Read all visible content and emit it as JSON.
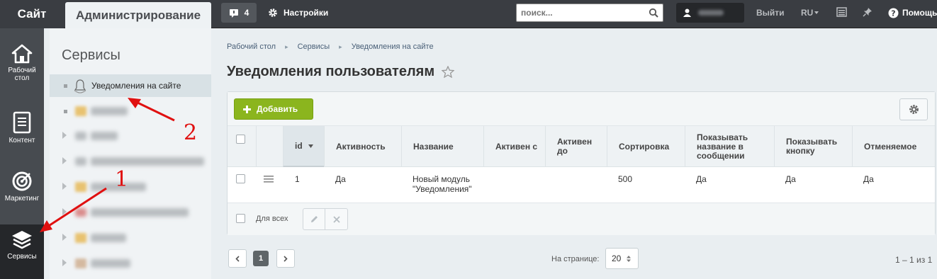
{
  "topbar": {
    "site_tab": "Сайт",
    "admin_tab": "Администрирование",
    "notifications_count": "4",
    "settings_label": "Настройки",
    "search_placeholder": "поиск...",
    "logout_label": "Выйти",
    "lang_label": "RU",
    "help_label": "Помощь"
  },
  "left_nav": {
    "items": [
      {
        "label": "Рабочий стол",
        "icon": "home-icon"
      },
      {
        "label": "Контент",
        "icon": "document-icon"
      },
      {
        "label": "Маркетинг",
        "icon": "target-icon"
      },
      {
        "label": "Сервисы",
        "icon": "layers-icon",
        "active": true
      }
    ]
  },
  "sidebar": {
    "title": "Сервисы",
    "active_item": "Уведомления на сайте"
  },
  "breadcrumbs": [
    "Рабочий стол",
    "Сервисы",
    "Уведомления на сайте"
  ],
  "page_title": "Уведомления пользователям",
  "toolbar": {
    "add_label": "Добавить"
  },
  "table": {
    "columns": [
      "id",
      "Активность",
      "Название",
      "Активен с",
      "Активен до",
      "Сортировка",
      "Показывать название в сообщении",
      "Показывать кнопку",
      "Отменяемое"
    ],
    "rows": [
      {
        "id": "1",
        "active": "Да",
        "name": "Новый модуль \"Уведомления\"",
        "active_from": "",
        "active_to": "",
        "sort": "500",
        "show_name": "Да",
        "show_button": "Да",
        "cancelable": "Да"
      }
    ],
    "for_all_label": "Для всех"
  },
  "pager": {
    "current_page": "1",
    "per_page_label": "На странице:",
    "per_page_value": "20",
    "count_label": "1 – 1 из 1"
  },
  "annotations": {
    "marker_1": "1",
    "marker_2": "2",
    "arrow_color": "#e01010"
  }
}
